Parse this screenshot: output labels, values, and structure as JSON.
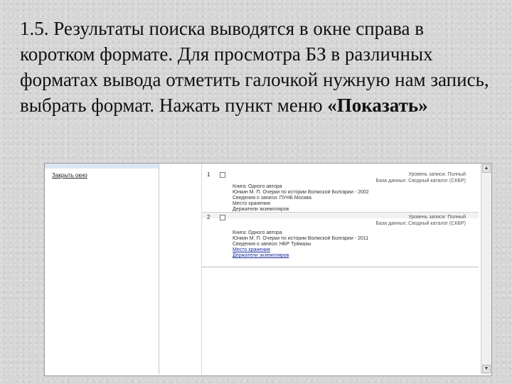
{
  "slide": {
    "text_main": "1.5. Результаты поиска выводятся в окне справа в коротком формате. Для просмотра БЗ в различных форматах вывода отметить галочкой нужную нам запись, выбрать формат. Нажать пункт меню ",
    "text_bold": "«Показать»"
  },
  "window": {
    "close_label": "Закрыть окно",
    "records": [
      {
        "number": "1",
        "meta_level": "Уровень записи: Полный",
        "meta_db": "База данных: Сводный каталог (СКБР)",
        "lines": [
          "Книга: Одного автора",
          "Юнкин М. П. Очерки по истории Волжской Болгарии - 2002",
          "Сведения о записи: ПУНБ Москва",
          "Место хранения",
          "Держатели экземпляров"
        ]
      },
      {
        "number": "2",
        "meta_level": "Уровень записи: Полный",
        "meta_db": "База данных: Сводный каталог (СКБР)",
        "lines": [
          "Книга: Одного автора",
          "Юнкин М. П. Очерки по истории Волжской Болгарии - 2011",
          "Сведения о записи: НБР Туймазы",
          "Место хранения",
          "Держатели экземпляров"
        ]
      }
    ],
    "scroll_up_glyph": "▲",
    "scroll_down_glyph": "▼"
  }
}
